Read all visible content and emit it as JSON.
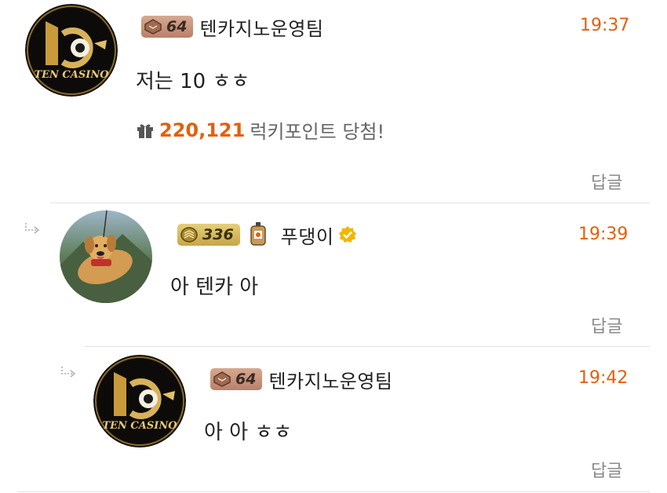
{
  "comments": [
    {
      "level": "64",
      "author": "텐카지노운영팀",
      "time": "19:37",
      "text": "저는 10 ㅎㅎ",
      "lucky_points": "220,121",
      "lucky_text": "럭키포인트 당첨!",
      "reply_label": "답글",
      "avatar_text": "TEN CASINO"
    },
    {
      "level": "336",
      "author": "푸댕이",
      "time": "19:39",
      "text": "아 텐카 아",
      "reply_label": "답글"
    },
    {
      "level": "64",
      "author": "텐카지노운영팀",
      "time": "19:42",
      "text": "아 아 ㅎㅎ",
      "reply_label": "답글",
      "avatar_text": "TEN CASINO"
    }
  ],
  "colors": {
    "accent": "#e2600b",
    "reply_gray": "#8a8a8a",
    "divider": "#e3e3e3",
    "verified": "#f2b705"
  },
  "icons": {
    "gift": "gift-icon",
    "reply_arrow": "reply-arrow-icon",
    "verified": "verified-badge-icon"
  }
}
